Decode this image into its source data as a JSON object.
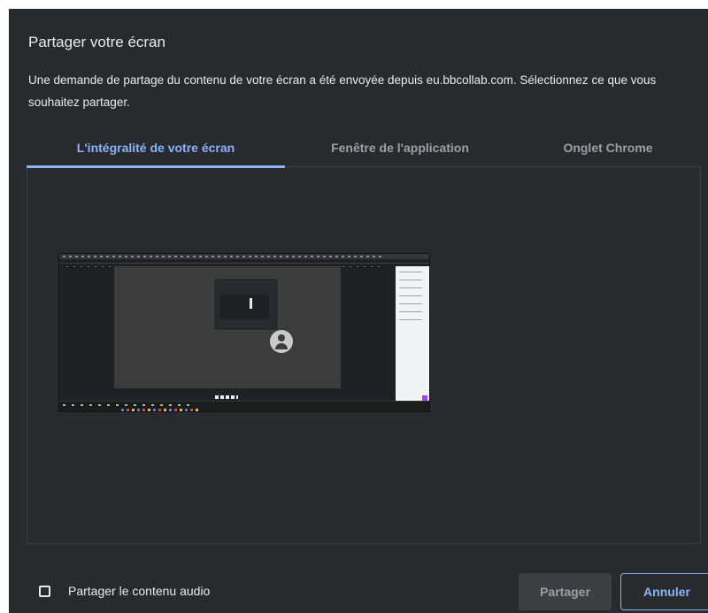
{
  "dialog": {
    "title": "Partager votre écran",
    "description": "Une demande de partage du contenu de votre écran a été envoyée depuis eu.bbcollab.com. Sélectionnez ce que vous souhaitez partager."
  },
  "tabs": [
    {
      "label": "L'intégralité de votre écran",
      "selected": true
    },
    {
      "label": "Fenêtre de l'application",
      "selected": false
    },
    {
      "label": "Onglet Chrome",
      "selected": false
    }
  ],
  "footer": {
    "audio_label": "Partager le contenu audio",
    "audio_checked": false,
    "share_label": "Partager",
    "cancel_label": "Annuler"
  },
  "colors": {
    "background": "#292a2d",
    "accent": "#8ab4f8",
    "text": "#e8eaed",
    "muted": "#9aa0a6"
  }
}
